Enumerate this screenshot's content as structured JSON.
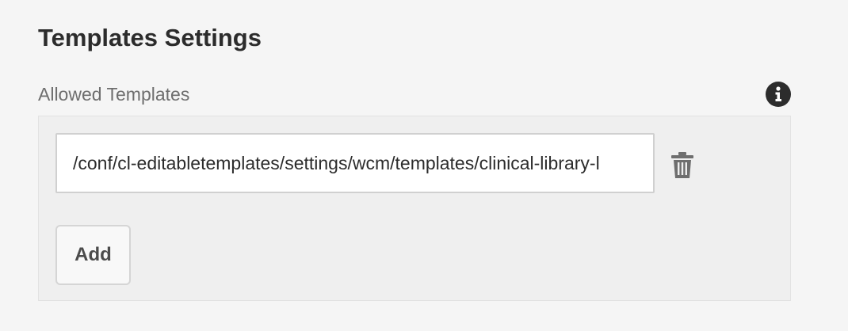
{
  "section": {
    "title": "Templates Settings"
  },
  "allowed_templates": {
    "label": "Allowed Templates",
    "info_icon": "info-icon",
    "items": [
      {
        "value": "/conf/cl-editabletemplates/settings/wcm/templates/clinical-library-l",
        "delete_icon": "trash-icon"
      }
    ],
    "add_label": "Add"
  },
  "colors": {
    "background": "#f5f5f5",
    "panel": "#efefef",
    "text": "#2c2c2c",
    "label": "#6e6e6e"
  }
}
